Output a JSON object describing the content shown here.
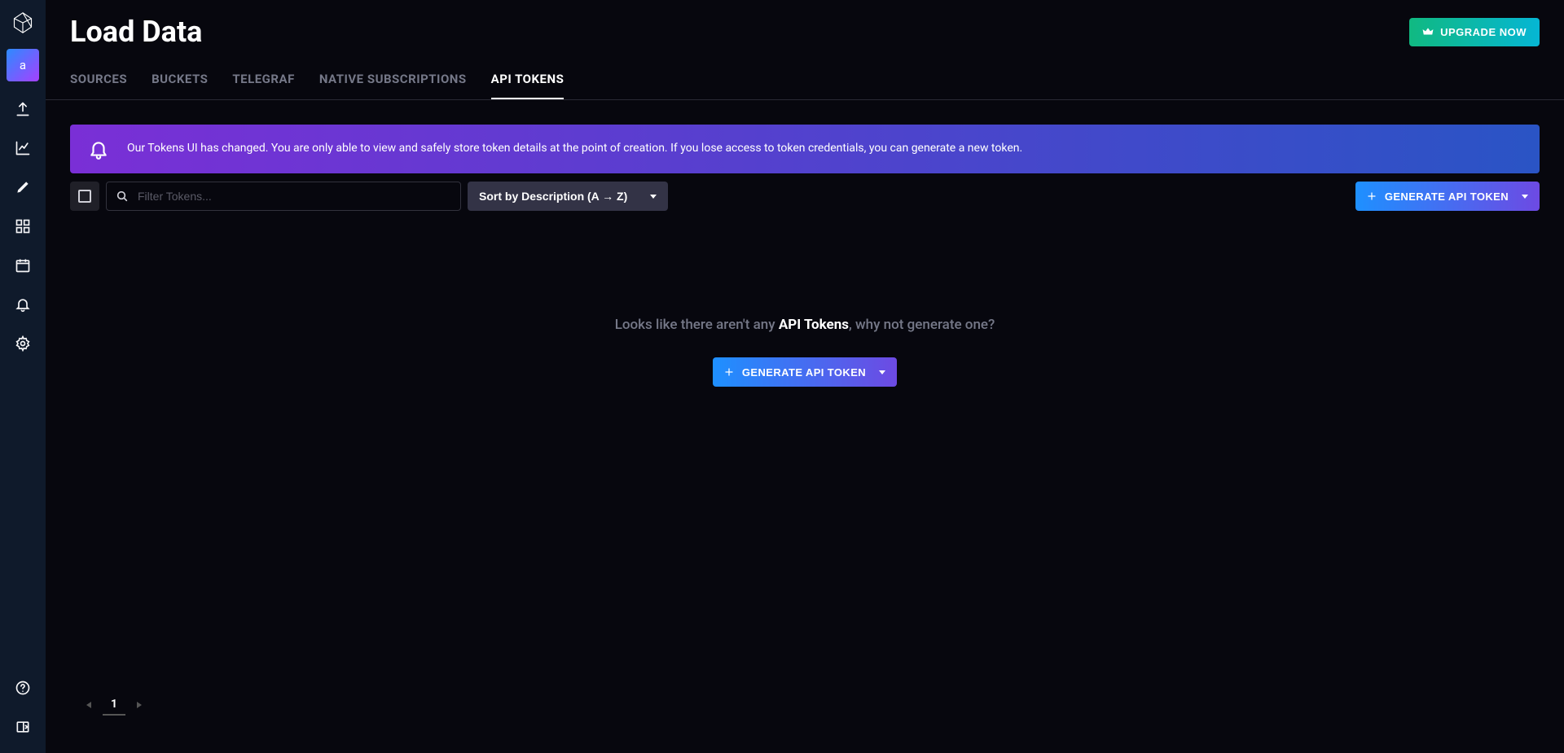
{
  "sidebar": {
    "org_letter": "a"
  },
  "header": {
    "title": "Load Data",
    "upgrade_label": "UPGRADE NOW"
  },
  "tabs": [
    {
      "label": "SOURCES",
      "active": false
    },
    {
      "label": "BUCKETS",
      "active": false
    },
    {
      "label": "TELEGRAF",
      "active": false
    },
    {
      "label": "NATIVE SUBSCRIPTIONS",
      "active": false
    },
    {
      "label": "API TOKENS",
      "active": true
    }
  ],
  "banner": {
    "text": "Our Tokens UI has changed. You are only able to view and safely store token details at the point of creation. If you lose access to token credentials, you can generate a new token."
  },
  "toolbar": {
    "filter_placeholder": "Filter Tokens...",
    "sort_label": "Sort by Description (A → Z)",
    "generate_label": "GENERATE API TOKEN"
  },
  "empty_state": {
    "prefix": "Looks like there aren't any ",
    "highlight": "API Tokens",
    "suffix": ", why not generate one?",
    "button_label": "GENERATE API TOKEN"
  },
  "pagination": {
    "current": "1"
  }
}
